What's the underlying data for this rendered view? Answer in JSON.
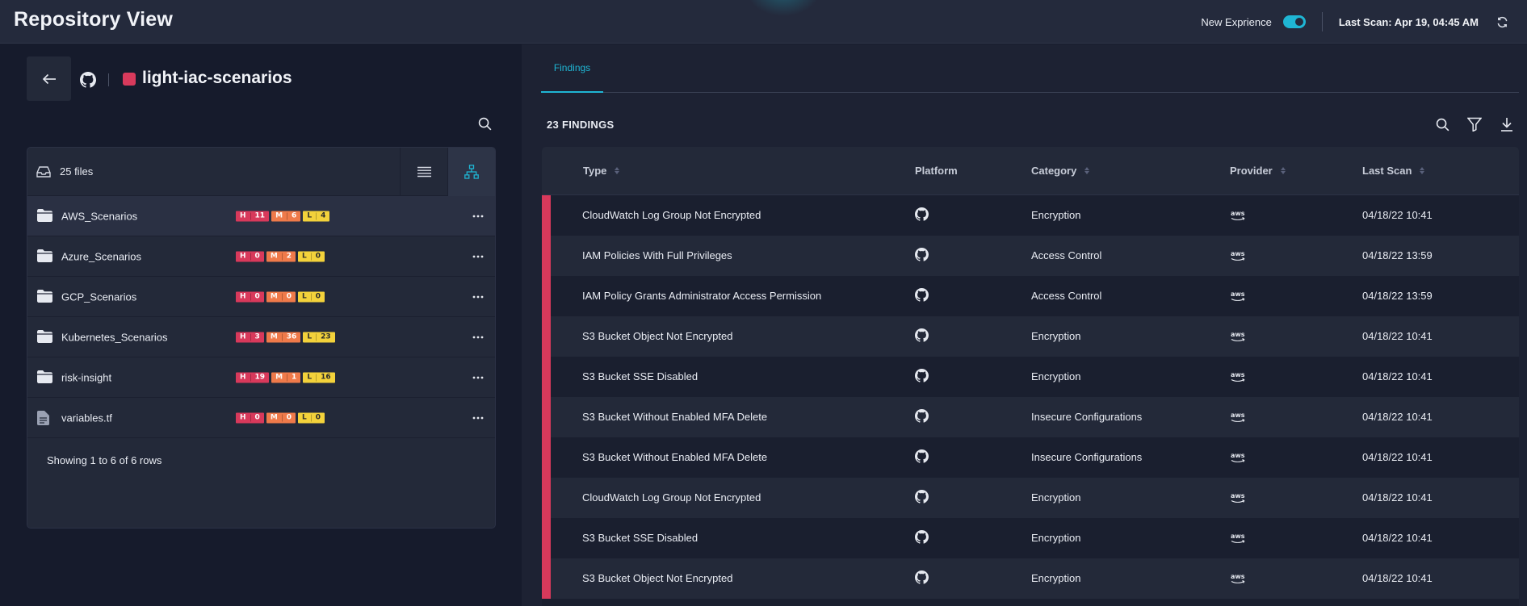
{
  "header": {
    "title": "Repository View",
    "new_experience_label": "New Exprience",
    "new_experience_on": true,
    "last_scan": "Last Scan: Apr 19, 04:45 AM",
    "accent_color": "#1fb6d4"
  },
  "repo": {
    "name": "light-iac-scenarios",
    "color": "#d83a5c",
    "source_icon": "github-icon"
  },
  "files": {
    "count_label": "25 files",
    "rows": [
      {
        "name": "AWS_Scenarios",
        "type": "folder",
        "h": "11",
        "m": "6",
        "l": "4"
      },
      {
        "name": "Azure_Scenarios",
        "type": "folder",
        "h": "0",
        "m": "2",
        "l": "0"
      },
      {
        "name": "GCP_Scenarios",
        "type": "folder",
        "h": "0",
        "m": "0",
        "l": "0"
      },
      {
        "name": "Kubernetes_Scenarios",
        "type": "folder",
        "h": "3",
        "m": "36",
        "l": "23"
      },
      {
        "name": "risk-insight",
        "type": "folder",
        "h": "19",
        "m": "1",
        "l": "16"
      },
      {
        "name": "variables.tf",
        "type": "file",
        "h": "0",
        "m": "0",
        "l": "0"
      }
    ],
    "footer": "Showing 1 to 6 of 6 rows",
    "severity_letters": {
      "h": "H",
      "m": "M",
      "l": "L"
    }
  },
  "findings": {
    "tab_label": "Findings",
    "count_label": "23 FINDINGS",
    "columns": {
      "type": "Type",
      "platform": "Platform",
      "category": "Category",
      "provider": "Provider",
      "last_scan": "Last Scan"
    },
    "rows": [
      {
        "type": "CloudWatch Log Group Not Encrypted",
        "platform": "github",
        "category": "Encryption",
        "provider": "aws",
        "last_scan": "04/18/22 10:41"
      },
      {
        "type": "IAM Policies With Full Privileges",
        "platform": "github",
        "category": "Access Control",
        "provider": "aws",
        "last_scan": "04/18/22 13:59"
      },
      {
        "type": "IAM Policy Grants Administrator Access Permission",
        "platform": "github",
        "category": "Access Control",
        "provider": "aws",
        "last_scan": "04/18/22 13:59"
      },
      {
        "type": "S3 Bucket Object Not Encrypted",
        "platform": "github",
        "category": "Encryption",
        "provider": "aws",
        "last_scan": "04/18/22 10:41"
      },
      {
        "type": "S3 Bucket SSE Disabled",
        "platform": "github",
        "category": "Encryption",
        "provider": "aws",
        "last_scan": "04/18/22 10:41"
      },
      {
        "type": "S3 Bucket Without Enabled MFA Delete",
        "platform": "github",
        "category": "Insecure Configurations",
        "provider": "aws",
        "last_scan": "04/18/22 10:41"
      },
      {
        "type": "S3 Bucket Without Enabled MFA Delete",
        "platform": "github",
        "category": "Insecure Configurations",
        "provider": "aws",
        "last_scan": "04/18/22 10:41"
      },
      {
        "type": "CloudWatch Log Group Not Encrypted",
        "platform": "github",
        "category": "Encryption",
        "provider": "aws",
        "last_scan": "04/18/22 10:41"
      },
      {
        "type": "S3 Bucket SSE Disabled",
        "platform": "github",
        "category": "Encryption",
        "provider": "aws",
        "last_scan": "04/18/22 10:41"
      },
      {
        "type": "S3 Bucket Object Not Encrypted",
        "platform": "github",
        "category": "Encryption",
        "provider": "aws",
        "last_scan": "04/18/22 10:41"
      }
    ],
    "severity_color": "#d8395b"
  }
}
